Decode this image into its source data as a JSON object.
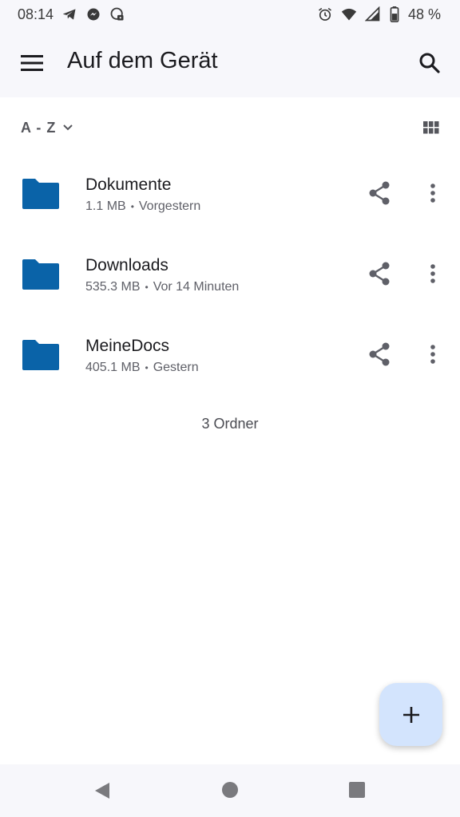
{
  "status_bar": {
    "time": "08:14",
    "battery": "48 %",
    "left_icons": [
      "telegram-icon",
      "messenger-icon",
      "vpn-icon"
    ],
    "right_icons": [
      "alarm-icon",
      "wifi-icon",
      "signal-icon",
      "battery-icon"
    ]
  },
  "app_bar": {
    "title": "Auf dem Gerät",
    "menu_icon": "menu-icon",
    "search_icon": "search-icon"
  },
  "sort": {
    "label": "A - Z",
    "view_icon": "grid-view-icon"
  },
  "files": [
    {
      "name": "Dokumente",
      "size": "1.1 MB",
      "separator": "•",
      "modified": "Vorgestern"
    },
    {
      "name": "Downloads",
      "size": "535.3 MB",
      "separator": "•",
      "modified": "Vor 14 Minuten"
    },
    {
      "name": "MeineDocs",
      "size": "405.1 MB",
      "separator": "•",
      "modified": "Gestern"
    }
  ],
  "footer": {
    "folder_count": "3 Ordner"
  },
  "fab": {
    "icon": "plus-icon"
  },
  "colors": {
    "folder": "#0a63a8",
    "fab_bg": "#d3e4fd",
    "bar_bg": "#f7f7fb",
    "icon_gray": "#5f6068"
  }
}
